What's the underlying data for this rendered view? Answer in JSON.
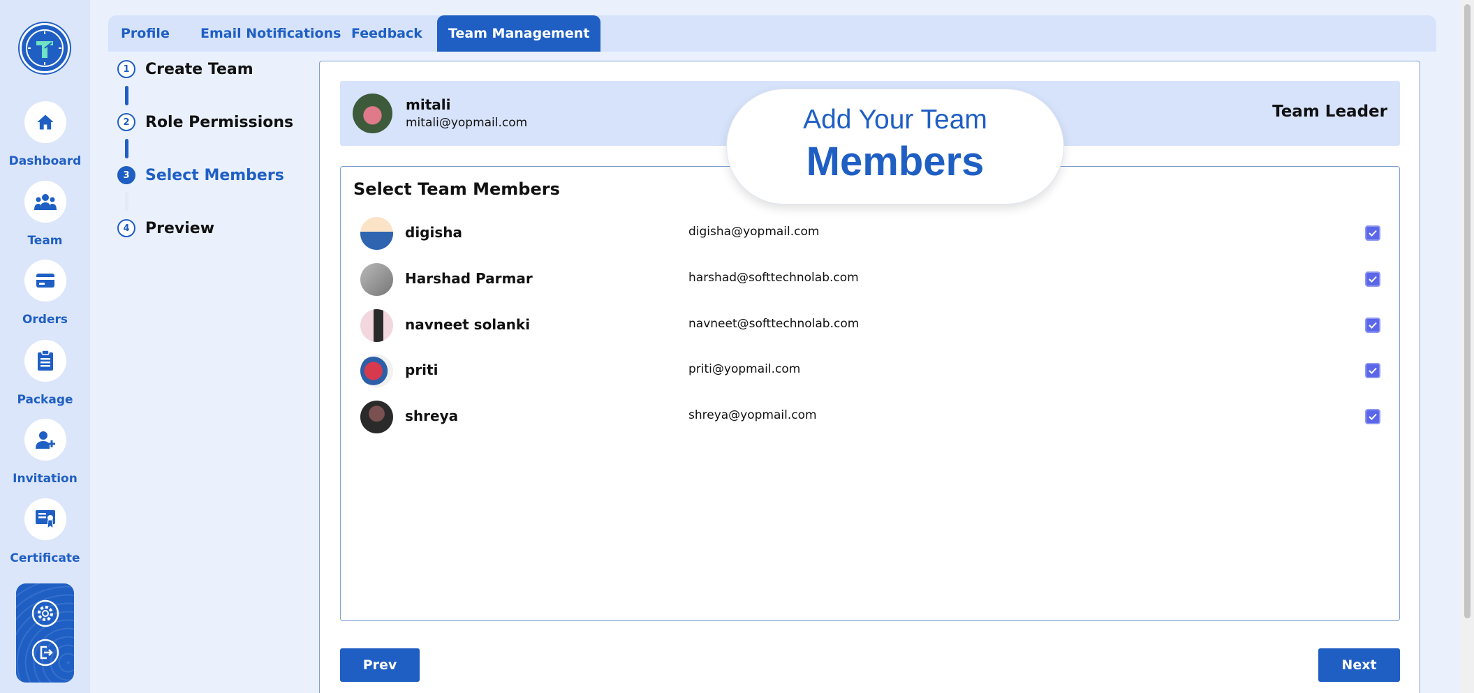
{
  "sidebar": {
    "items": [
      {
        "label": "Dashboard",
        "icon": "home-icon"
      },
      {
        "label": "Team",
        "icon": "team-icon"
      },
      {
        "label": "Orders",
        "icon": "card-icon"
      },
      {
        "label": "Package",
        "icon": "clipboard-icon"
      },
      {
        "label": "Invitation",
        "icon": "add-user-icon"
      },
      {
        "label": "Certificate",
        "icon": "certificate-icon"
      }
    ],
    "bottom_icons": [
      "gear-icon",
      "logout-icon"
    ]
  },
  "tabs": [
    {
      "label": "Profile",
      "active": false
    },
    {
      "label": "Email Notifications",
      "active": false
    },
    {
      "label": "Feedback",
      "active": false
    },
    {
      "label": "Team Management",
      "active": true
    }
  ],
  "steps": [
    {
      "num": "1",
      "label": "Create Team",
      "state": "done"
    },
    {
      "num": "2",
      "label": "Role Permissions",
      "state": "done"
    },
    {
      "num": "3",
      "label": "Select Members",
      "state": "current"
    },
    {
      "num": "4",
      "label": "Preview",
      "state": "pending"
    }
  ],
  "leader": {
    "name": "mitali",
    "email": "mitali@yopmail.com",
    "role": "Team Leader"
  },
  "members": {
    "title": "Select Team Members",
    "rows": [
      {
        "name": "digisha",
        "email": "digisha@yopmail.com",
        "checked": true
      },
      {
        "name": "Harshad Parmar",
        "email": "harshad@softtechnolab.com",
        "checked": true
      },
      {
        "name": "navneet solanki",
        "email": "navneet@softtechnolab.com",
        "checked": true
      },
      {
        "name": "priti",
        "email": "priti@yopmail.com",
        "checked": true
      },
      {
        "name": "shreya",
        "email": "shreya@yopmail.com",
        "checked": true
      }
    ]
  },
  "buttons": {
    "prev": "Prev",
    "next": "Next"
  },
  "bubble": {
    "line1": "Add Your Team",
    "line2": "Members"
  },
  "colors": {
    "accent": "#1f5fc4",
    "sidebar_bg": "#dce6fa",
    "checkbox": "#5b67e8"
  }
}
